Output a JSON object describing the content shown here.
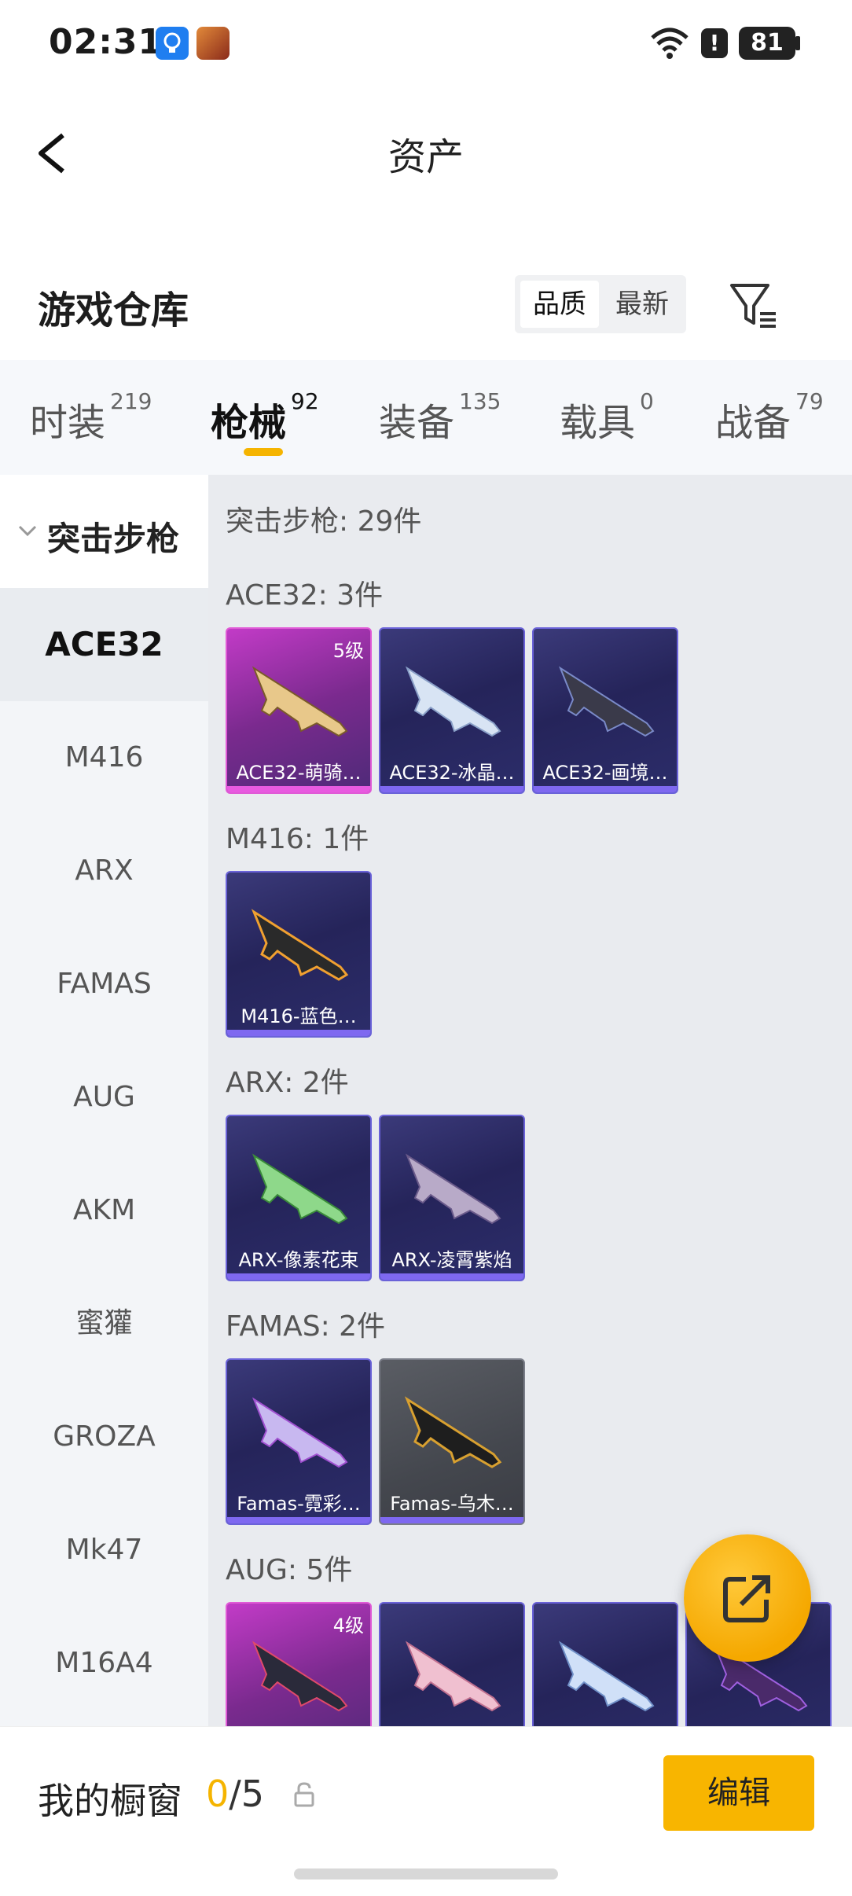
{
  "status_bar": {
    "time": "02:31",
    "battery": "81"
  },
  "header": {
    "title": "资产"
  },
  "section": {
    "title": "游戏仓库",
    "sort_options": [
      "品质",
      "最新"
    ]
  },
  "tabs": [
    {
      "label": "时装",
      "count": "219"
    },
    {
      "label": "枪械",
      "count": "92"
    },
    {
      "label": "装备",
      "count": "135"
    },
    {
      "label": "载具",
      "count": "0"
    },
    {
      "label": "战备",
      "count": "79"
    }
  ],
  "sidebar": {
    "category": "突击步枪",
    "items": [
      "ACE32",
      "M416",
      "ARX",
      "FAMAS",
      "AUG",
      "AKM",
      "蜜獾",
      "GROZA",
      "Mk47",
      "M16A4"
    ]
  },
  "content": {
    "summary": "突击步枪: 29件",
    "groups": [
      {
        "title": "ACE32: 3件",
        "items": [
          {
            "name": "ACE32-萌骑…",
            "level": "5级"
          },
          {
            "name": "ACE32-冰晶…"
          },
          {
            "name": "ACE32-画境…"
          }
        ]
      },
      {
        "title": "M416: 1件",
        "items": [
          {
            "name": "M416-蓝色…"
          }
        ]
      },
      {
        "title": "ARX: 2件",
        "items": [
          {
            "name": "ARX-像素花束"
          },
          {
            "name": "ARX-凌霄紫焰"
          }
        ]
      },
      {
        "title": "FAMAS: 2件",
        "items": [
          {
            "name": "Famas-霓彩…"
          },
          {
            "name": "Famas-乌木…"
          }
        ]
      },
      {
        "title": "AUG: 5件",
        "items": [
          {
            "name": "",
            "level": "4级"
          },
          {
            "name": ""
          },
          {
            "name": ""
          },
          {
            "name": ""
          }
        ]
      }
    ]
  },
  "bottom_bar": {
    "label": "我的橱窗",
    "count_current": "0",
    "count_sep_total": "/5",
    "edit_label": "编辑"
  },
  "colors": {
    "accent": "#f8b500",
    "purple_card": "#c23bc7",
    "blue_card": "#3b3a7a"
  }
}
